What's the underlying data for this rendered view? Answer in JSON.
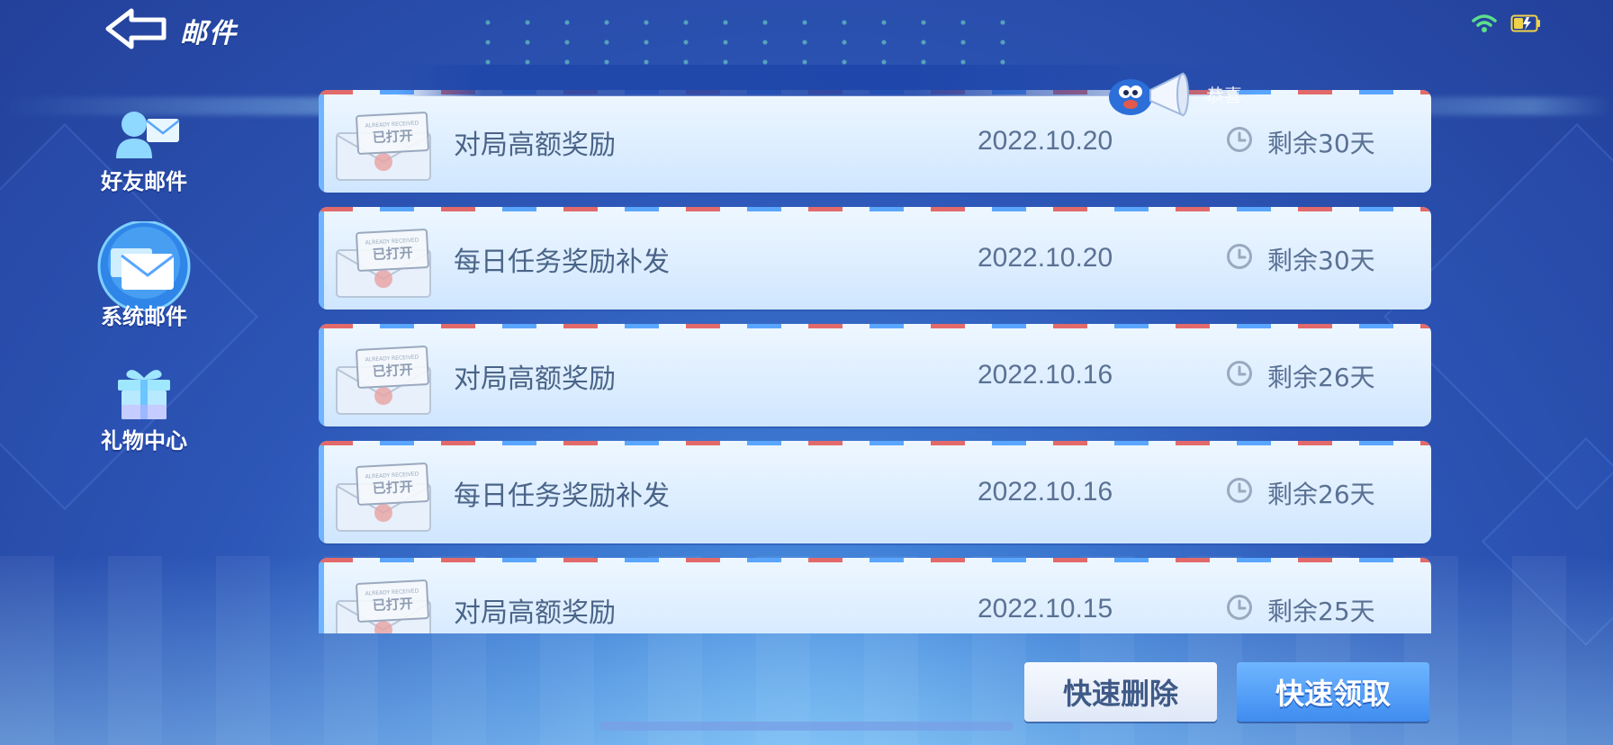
{
  "header": {
    "title": "邮件",
    "back_icon": "back-arrow-icon",
    "status": {
      "wifi_icon": "wifi-icon",
      "battery_icon": "battery-charging-icon",
      "wifi_color": "#5de08a",
      "battery_color": "#f0d24a"
    }
  },
  "sidebar": {
    "items": [
      {
        "label": "好友邮件",
        "icon": "friend-mail-icon",
        "active": false
      },
      {
        "label": "系统邮件",
        "icon": "system-mail-icon",
        "active": true
      },
      {
        "label": "礼物中心",
        "icon": "gift-icon",
        "active": false
      }
    ]
  },
  "broadcast": {
    "text": "恭喜"
  },
  "mails": [
    {
      "stamp_small": "ALREADY RECEIVED",
      "stamp": "已打开",
      "title": "对局高额奖励",
      "date": "2022.10.20",
      "remaining": "剩余30天"
    },
    {
      "stamp_small": "ALREADY RECEIVED",
      "stamp": "已打开",
      "title": "每日任务奖励补发",
      "date": "2022.10.20",
      "remaining": "剩余30天"
    },
    {
      "stamp_small": "ALREADY RECEIVED",
      "stamp": "已打开",
      "title": "对局高额奖励",
      "date": "2022.10.16",
      "remaining": "剩余26天"
    },
    {
      "stamp_small": "ALREADY RECEIVED",
      "stamp": "已打开",
      "title": "每日任务奖励补发",
      "date": "2022.10.16",
      "remaining": "剩余26天"
    },
    {
      "stamp_small": "ALREADY RECEIVED",
      "stamp": "已打开",
      "title": "对局高额奖励",
      "date": "2022.10.15",
      "remaining": "剩余25天"
    }
  ],
  "actions": {
    "quick_delete": "快速删除",
    "quick_claim": "快速领取"
  },
  "colors": {
    "background": "#2d57b8",
    "card": "#e4f1ff",
    "accent": "#3f8cf0",
    "text": "#4a6488",
    "airmail_red": "#e36a6a",
    "airmail_blue": "#5aa6ff"
  }
}
